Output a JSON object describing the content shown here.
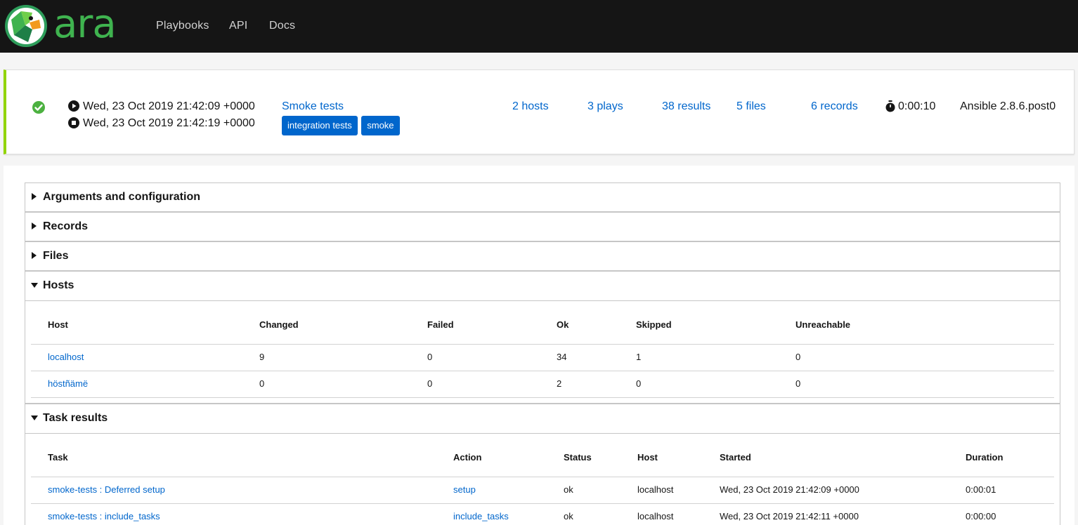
{
  "header": {
    "logo_text": "ara",
    "nav": [
      "Playbooks",
      "API",
      "Docs"
    ]
  },
  "summary": {
    "status_icon": "check-circle-icon",
    "status_color": "#3e8635",
    "started": "Wed, 23 Oct 2019 21:42:09 +0000",
    "ended": "Wed, 23 Oct 2019 21:42:19 +0000",
    "name": "Smoke tests",
    "labels": [
      "integration tests",
      "smoke"
    ],
    "hosts": "2 hosts",
    "plays": "3 plays",
    "results": "38 results",
    "files": "5 files",
    "records": "6 records",
    "duration": "0:00:10",
    "ansible_version": "Ansible 2.8.6.post0",
    "accent_color": "#92d400",
    "link_color": "#0066cc"
  },
  "sections": {
    "arguments": "Arguments and configuration",
    "records": "Records",
    "files": "Files",
    "hosts": "Hosts",
    "task_results": "Task results"
  },
  "hosts_table": {
    "columns": [
      "Host",
      "Changed",
      "Failed",
      "Ok",
      "Skipped",
      "Unreachable"
    ],
    "rows": [
      [
        "localhost",
        "9",
        "0",
        "34",
        "1",
        "0"
      ],
      [
        "höstñämë",
        "0",
        "0",
        "2",
        "0",
        "0"
      ]
    ]
  },
  "results_table": {
    "columns": [
      "Task",
      "Action",
      "Status",
      "Host",
      "Started",
      "Duration"
    ],
    "rows": [
      [
        "smoke-tests : Deferred setup",
        "setup",
        "ok",
        "localhost",
        "Wed, 23 Oct 2019 21:42:09 +0000",
        "0:00:01"
      ],
      [
        "smoke-tests : include_tasks",
        "include_tasks",
        "ok",
        "localhost",
        "Wed, 23 Oct 2019 21:42:11 +0000",
        "0:00:00"
      ]
    ]
  }
}
